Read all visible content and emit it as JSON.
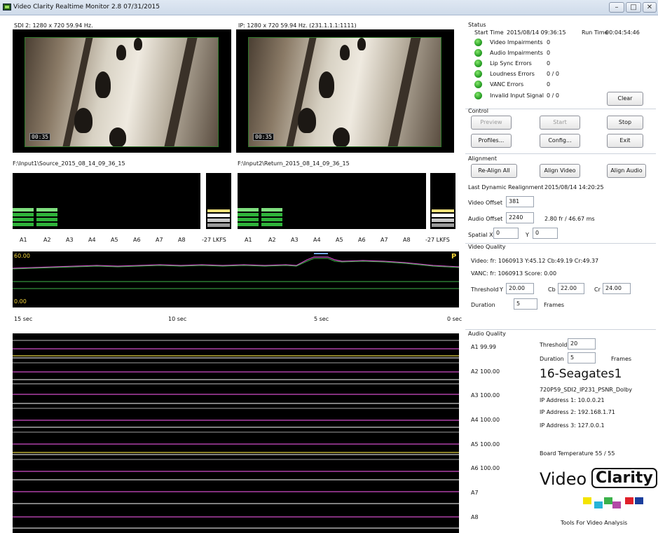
{
  "window": {
    "title": "Video Clarity Realtime Monitor 2.8 07/31/2015"
  },
  "video": {
    "left_label": "SDI 2: 1280 x 720 59.94 Hz.",
    "right_label": "IP: 1280 x 720 59.94 Hz. (231.1.1.1:1111)",
    "left_timecode": "00:35",
    "right_timecode": "00:35",
    "left_file": "F:\\Input1\\Source_2015_08_14_09_36_15",
    "right_file": "F:\\Input2\\Return_2015_08_14_09_36_15"
  },
  "meters": {
    "channels_left": [
      "A1",
      "A2",
      "A3",
      "A4",
      "A5",
      "A6",
      "A7",
      "A8",
      "-27 LKFS"
    ],
    "channels_right": [
      "A1",
      "A2",
      "A3",
      "A4",
      "A5",
      "A6",
      "A7",
      "A8",
      "-27 LKFS"
    ]
  },
  "graph1": {
    "top_value": "60.00",
    "bottom_value": "0.00",
    "marker": "P"
  },
  "time_axis": [
    "15 sec",
    "10 sec",
    "5 sec",
    "0 sec"
  ],
  "status": {
    "title": "Status",
    "start_time_label": "Start Time",
    "start_time": "2015/08/14 09:36:15",
    "run_time_label": "Run Time",
    "run_time": "00:04:54:46",
    "rows": [
      {
        "label": "Video Impairments",
        "value": "0"
      },
      {
        "label": "Audio Impairments",
        "value": "0"
      },
      {
        "label": "Lip Sync Errors",
        "value": "0"
      },
      {
        "label": "Loudness Errors",
        "value": "0 / 0"
      },
      {
        "label": "VANC Errors",
        "value": "0"
      },
      {
        "label": "Invalid Input Signal",
        "value": "0 / 0"
      }
    ],
    "clear_label": "Clear"
  },
  "control": {
    "title": "Control",
    "preview": "Preview",
    "start": "Start",
    "stop": "Stop",
    "profiles": "Profiles...",
    "config": "Config...",
    "exit": "Exit"
  },
  "alignment": {
    "title": "Alignment",
    "realign_all": "Re-Align All",
    "align_video": "Align Video",
    "align_audio": "Align Audio",
    "last_label": "Last Dynamic Realignment",
    "last_value": "2015/08/14 14:20:25",
    "video_offset_label": "Video Offset",
    "video_offset": "381",
    "audio_offset_label": "Audio Offset",
    "audio_offset": "2240",
    "audio_offset_info": "2.80 fr / 46.67 ms",
    "spatial_x_label": "Spatial X",
    "spatial_x": "0",
    "y_label": "Y",
    "spatial_y": "0"
  },
  "video_quality": {
    "title": "Video Quality",
    "video_line": "Video:  fr: 1060913  Y:45.12  Cb:49.19  Cr:49.37",
    "vanc_line": "VANC:  fr: 1060913  Score: 0.00",
    "threshold_label": "Threshold",
    "y_label": "Y",
    "y_value": "20.00",
    "cb_label": "Cb",
    "cb_value": "22.00",
    "cr_label": "Cr",
    "cr_value": "24.00",
    "duration_label": "Duration",
    "duration_value": "5",
    "frames_label": "Frames"
  },
  "audio_quality": {
    "title": "Audio Quality",
    "channels": [
      "A1 99.99",
      "A2 100.00",
      "A3 100.00",
      "A4 100.00",
      "A5 100.00",
      "A6 100.00",
      "A7",
      "A8"
    ],
    "threshold_label": "Threshold",
    "threshold_value": "20",
    "duration_label": "Duration",
    "duration_value": "5",
    "frames_label": "Frames"
  },
  "device": {
    "name": "16-Seagates1",
    "profile": "720P59_SDI2_IP231_PSNR_Dolby",
    "ip1": "IP Address 1: 10.0.0.21",
    "ip2": "IP Address 2: 192.168.1.71",
    "ip3": "IP Address 3: 127.0.0.1",
    "board_temp": "Board Temperature  55 / 55"
  },
  "brand": {
    "word1": "Video",
    "word2": "Clarity",
    "tagline": "Tools For Video Analysis",
    "swatches": [
      "#ffffff",
      "#f4e400",
      "#27b4d8",
      "#3bb24a",
      "#b24aa6",
      "#e0202a",
      "#1a3e9c"
    ]
  }
}
